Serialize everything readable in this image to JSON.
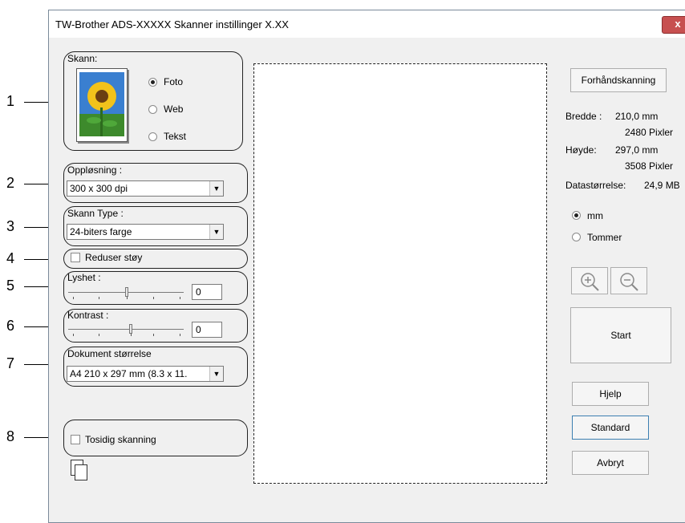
{
  "window": {
    "title": "TW-Brother ADS-XXXXX Skanner instillinger X.XX",
    "close_label": "x"
  },
  "callouts": [
    "1",
    "2",
    "3",
    "4",
    "5",
    "6",
    "7",
    "8"
  ],
  "scan_group": {
    "label": "Skann:",
    "options": [
      "Foto",
      "Web",
      "Tekst"
    ],
    "selected": "Foto"
  },
  "resolution": {
    "label": "Oppløsning :",
    "value": "300 x 300 dpi"
  },
  "scan_type": {
    "label": "Skann Type :",
    "value": "24-biters farge"
  },
  "noise": {
    "label": "Reduser støy",
    "checked": false
  },
  "brightness": {
    "label": "Lyshet :",
    "value": "0",
    "level": 0
  },
  "contrast": {
    "label": "Kontrast :",
    "value": "0",
    "level": 0
  },
  "doc_size": {
    "label": "Dokument størrelse",
    "value": "A4 210 x 297 mm (8.3 x 11."
  },
  "duplex": {
    "label": "Tosidig skanning",
    "checked": false
  },
  "right_panel": {
    "prescan_label": "Forhåndskanning",
    "width_label": "Bredde :",
    "width_mm": "210,0 mm",
    "width_px": "2480 Pixler",
    "height_label": "Høyde:",
    "height_mm": "297,0 mm",
    "height_px": "3508 Pixler",
    "datasize_label": "Datastørrelse:",
    "datasize_value": "24,9 MB",
    "unit_options": [
      "mm",
      "Tommer"
    ],
    "unit_selected": "mm",
    "start_label": "Start",
    "help_label": "Hjelp",
    "default_label": "Standard",
    "cancel_label": "Avbryt"
  }
}
